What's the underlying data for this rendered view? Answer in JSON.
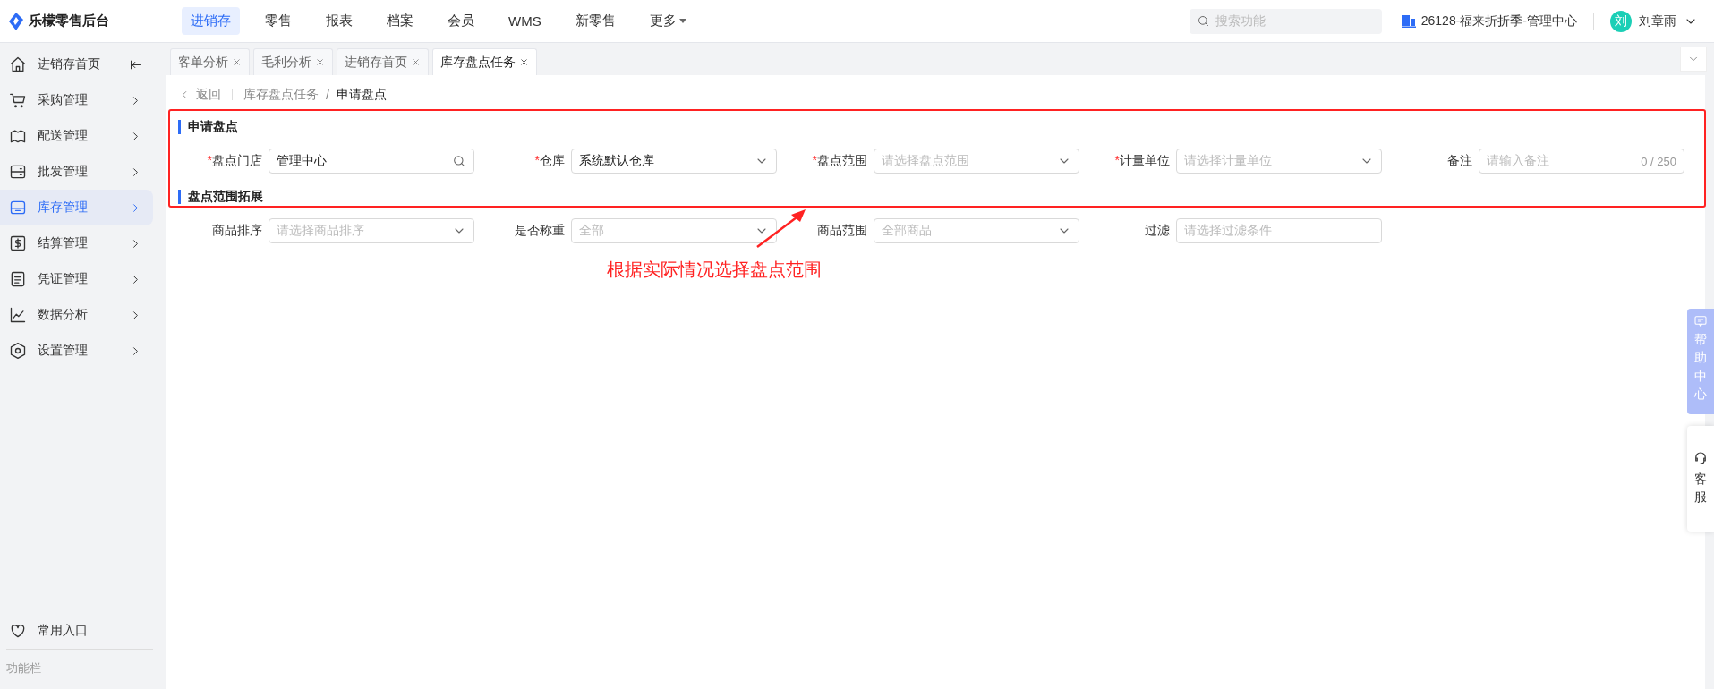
{
  "top_bar": {
    "brand": "乐檬零售后台",
    "nav": [
      {
        "label": "进销存",
        "selected": true
      },
      {
        "label": "零售",
        "selected": false
      },
      {
        "label": "报表",
        "selected": false
      },
      {
        "label": "档案",
        "selected": false
      },
      {
        "label": "会员",
        "selected": false
      },
      {
        "label": "WMS",
        "selected": false
      },
      {
        "label": "新零售",
        "selected": false
      },
      {
        "label": "更多",
        "selected": false,
        "dropdown": true
      }
    ],
    "search": {
      "placeholder": "搜索功能"
    },
    "org": "26128-福来折折季-管理中心",
    "avatar": "刘",
    "user": "刘章雨"
  },
  "sidebar": {
    "items": [
      {
        "label": "进销存首页",
        "selected": false,
        "collapse": true
      },
      {
        "label": "采购管理",
        "selected": false
      },
      {
        "label": "配送管理",
        "selected": false
      },
      {
        "label": "批发管理",
        "selected": false
      },
      {
        "label": "库存管理",
        "selected": true
      },
      {
        "label": "结算管理",
        "selected": false
      },
      {
        "label": "凭证管理",
        "selected": false
      },
      {
        "label": "数据分析",
        "selected": false
      },
      {
        "label": "设置管理",
        "selected": false
      }
    ],
    "favorites": "常用入口",
    "footer": "功能栏"
  },
  "tabs": [
    {
      "label": "客单分析",
      "selected": false
    },
    {
      "label": "毛利分析",
      "selected": false
    },
    {
      "label": "进销存首页",
      "selected": false
    },
    {
      "label": "库存盘点任务",
      "selected": true
    }
  ],
  "breadcrumb": {
    "back": "返回",
    "separator": "/",
    "items": [
      "库存盘点任务",
      "申请盘点"
    ]
  },
  "required_mark": "*",
  "sections": [
    {
      "title": "申请盘点",
      "fields": [
        {
          "label": "盘点门店",
          "required": true,
          "kind": "search",
          "value": "管理中心"
        },
        {
          "label": "仓库",
          "required": true,
          "kind": "select",
          "value": "系统默认仓库"
        },
        {
          "label": "盘点范围",
          "required": true,
          "kind": "select",
          "placeholder": "请选择盘点范围"
        },
        {
          "label": "计量单位",
          "required": true,
          "kind": "select",
          "placeholder": "请选择计量单位"
        },
        {
          "label": "备注",
          "required": false,
          "kind": "text",
          "placeholder": "请输入备注",
          "counter": "0 / 250"
        }
      ]
    },
    {
      "title": "盘点范围拓展",
      "fields": [
        {
          "label": "商品排序",
          "required": false,
          "kind": "select",
          "placeholder": "请选择商品排序"
        },
        {
          "label": "是否称重",
          "required": false,
          "kind": "select",
          "placeholder": "全部"
        },
        {
          "label": "商品范围",
          "required": false,
          "kind": "select",
          "placeholder": "全部商品"
        },
        {
          "label": "过滤",
          "required": false,
          "kind": "text",
          "placeholder": "请选择过滤条件"
        }
      ]
    }
  ],
  "annotation": "根据实际情况选择盘点范围",
  "side_widgets": {
    "help": "帮助中心",
    "service": "客服"
  }
}
